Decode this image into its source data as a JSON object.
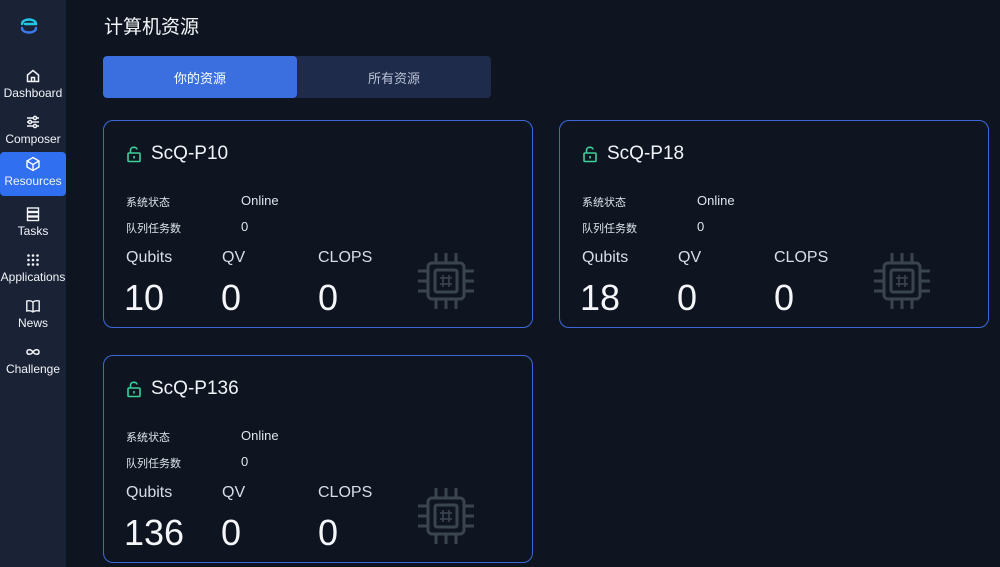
{
  "sidebar": {
    "items": [
      {
        "label": "Dashboard",
        "icon": "home-icon"
      },
      {
        "label": "Composer",
        "icon": "sliders-icon"
      },
      {
        "label": "Resources",
        "icon": "cube-icon"
      },
      {
        "label": "Tasks",
        "icon": "list-icon"
      },
      {
        "label": "Applications",
        "icon": "grid-icon"
      },
      {
        "label": "News",
        "icon": "book-icon"
      },
      {
        "label": "Challenge",
        "icon": "infinity-icon"
      }
    ],
    "active": "Resources"
  },
  "page": {
    "title": "计算机资源"
  },
  "tabs": [
    {
      "label": "你的资源",
      "active": true
    },
    {
      "label": "所有资源",
      "active": false
    }
  ],
  "cards": [
    {
      "name": "ScQ-P10",
      "status_label": "系统状态",
      "status": "Online",
      "queue_label": "队列任务数",
      "queue": "0",
      "qubits_label": "Qubits",
      "qubits": "10",
      "qv_label": "QV",
      "qv": "0",
      "clops_label": "CLOPS",
      "clops": "0"
    },
    {
      "name": "ScQ-P18",
      "status_label": "系统状态",
      "status": "Online",
      "queue_label": "队列任务数",
      "queue": "0",
      "qubits_label": "Qubits",
      "qubits": "18",
      "qv_label": "QV",
      "qv": "0",
      "clops_label": "CLOPS",
      "clops": "0"
    },
    {
      "name": "ScQ-P136",
      "status_label": "系统状态",
      "status": "Online",
      "queue_label": "队列任务数",
      "queue": "0",
      "qubits_label": "Qubits",
      "qubits": "136",
      "qv_label": "QV",
      "qv": "0",
      "clops_label": "CLOPS",
      "clops": "0"
    }
  ],
  "colors": {
    "accent": "#3b6fe0",
    "card_border": "#3d68d8",
    "lock": "#3ccf9a",
    "chip": "#3a4350"
  }
}
